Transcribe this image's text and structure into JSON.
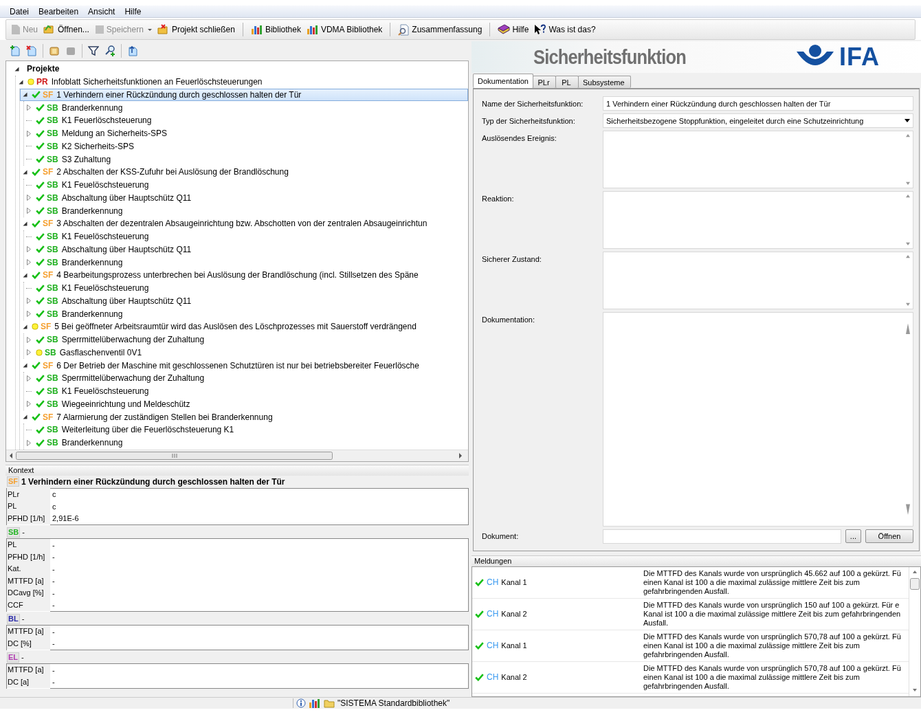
{
  "menu": [
    {
      "label": "Datei"
    },
    {
      "label": "Bearbeiten"
    },
    {
      "label": "Ansicht"
    },
    {
      "label": "Hilfe"
    }
  ],
  "toolbar": {
    "groups": [
      {
        "buttons": [
          {
            "label": "Neu",
            "disabled": true,
            "dropdown": false
          },
          {
            "label": "Öffnen...",
            "disabled": false,
            "dropdown": false
          },
          {
            "label": "Speichern",
            "disabled": true,
            "dropdown": true
          },
          {
            "label": "Projekt schließen",
            "disabled": false,
            "dropdown": false
          }
        ]
      },
      {
        "buttons": [
          {
            "label": "Bibliothek",
            "disabled": false,
            "dropdown": false
          },
          {
            "label": "VDMA Bibliothek",
            "disabled": false,
            "dropdown": false
          }
        ]
      },
      {
        "buttons": [
          {
            "label": "Zusammenfassung",
            "disabled": false,
            "dropdown": false
          }
        ]
      },
      {
        "buttons": [
          {
            "label": "Hilfe",
            "disabled": false,
            "dropdown": false
          },
          {
            "label": "Was ist das?",
            "disabled": false,
            "dropdown": false
          }
        ]
      }
    ]
  },
  "tree": {
    "items": [
      {
        "kind": "root",
        "label": "Projekte",
        "expanded": true,
        "selected": false,
        "children": [
          {
            "kind": "project",
            "tag": "PR",
            "complete": false,
            "label": "Infoblatt Sicherheitsfunktionen an Feuerlöschsteuerungen",
            "expanded": true,
            "selected": false,
            "children": [
              {
                "kind": "function",
                "tag": "SF",
                "complete": true,
                "label": "1 Verhindern einer Rückzündung durch geschlossen halten der Tür",
                "expanded": true,
                "selected": true,
                "children": [
                  {
                    "kind": "subsystem",
                    "tag": "SB",
                    "complete": true,
                    "label": "Branderkennung",
                    "expanded": false,
                    "selected": false
                  },
                  {
                    "kind": "subsystem",
                    "tag": "SB",
                    "complete": true,
                    "label": "K1 Feuerlöschsteuerung",
                    "selected": false
                  },
                  {
                    "kind": "subsystem",
                    "tag": "SB",
                    "complete": true,
                    "label": "Meldung an Sicherheits-SPS",
                    "expanded": false,
                    "selected": false
                  },
                  {
                    "kind": "subsystem",
                    "tag": "SB",
                    "complete": true,
                    "label": "K2 Sicherheits-SPS",
                    "selected": false
                  },
                  {
                    "kind": "subsystem",
                    "tag": "SB",
                    "complete": true,
                    "label": "S3 Zuhaltung",
                    "selected": false
                  }
                ]
              },
              {
                "kind": "function",
                "tag": "SF",
                "complete": true,
                "label": "2 Abschalten der KSS-Zufuhr bei Auslösung der Brandlöschung",
                "expanded": true,
                "selected": false,
                "children": [
                  {
                    "kind": "subsystem",
                    "tag": "SB",
                    "complete": true,
                    "label": "K1 Feuelöschsteuerung",
                    "selected": false
                  },
                  {
                    "kind": "subsystem",
                    "tag": "SB",
                    "complete": true,
                    "label": "Abschaltung über Hauptschütz Q11",
                    "expanded": false,
                    "selected": false
                  },
                  {
                    "kind": "subsystem",
                    "tag": "SB",
                    "complete": true,
                    "label": "Branderkennung",
                    "expanded": false,
                    "selected": false
                  }
                ]
              },
              {
                "kind": "function",
                "tag": "SF",
                "complete": true,
                "label": "3 Abschalten der dezentralen Absaugeinrichtung bzw. Abschotten von der zentralen Absaugeinrichtun",
                "expanded": true,
                "selected": false,
                "children": [
                  {
                    "kind": "subsystem",
                    "tag": "SB",
                    "complete": true,
                    "label": "K1 Feuelöschsteuerung",
                    "selected": false
                  },
                  {
                    "kind": "subsystem",
                    "tag": "SB",
                    "complete": true,
                    "label": "Abschaltung über Hauptschütz Q11",
                    "expanded": false,
                    "selected": false
                  },
                  {
                    "kind": "subsystem",
                    "tag": "SB",
                    "complete": true,
                    "label": "Branderkennung",
                    "expanded": false,
                    "selected": false
                  }
                ]
              },
              {
                "kind": "function",
                "tag": "SF",
                "complete": true,
                "label": "4 Bearbeitungsprozess unterbrechen bei Auslösung der Brandlöschung (incl. Stillsetzen des Späne",
                "expanded": true,
                "selected": false,
                "children": [
                  {
                    "kind": "subsystem",
                    "tag": "SB",
                    "complete": true,
                    "label": "K1 Feuelöschsteuerung",
                    "selected": false
                  },
                  {
                    "kind": "subsystem",
                    "tag": "SB",
                    "complete": true,
                    "label": "Abschaltung über Hauptschütz Q11",
                    "expanded": false,
                    "selected": false
                  },
                  {
                    "kind": "subsystem",
                    "tag": "SB",
                    "complete": true,
                    "label": "Branderkennung",
                    "expanded": false,
                    "selected": false
                  }
                ]
              },
              {
                "kind": "function",
                "tag": "SF",
                "complete": false,
                "label": "5 Bei geöffneter Arbeitsraumtür wird das Auslösen des Löschprozesses mit Sauerstoff verdrängend",
                "expanded": true,
                "selected": false,
                "children": [
                  {
                    "kind": "subsystem",
                    "tag": "SB",
                    "complete": true,
                    "label": "Sperrmittelüberwachung der Zuhaltung",
                    "expanded": false,
                    "selected": false
                  },
                  {
                    "kind": "subsystem",
                    "tag": "SB",
                    "complete": false,
                    "label": "Gasflaschenventil 0V1",
                    "expanded": false,
                    "selected": false
                  }
                ]
              },
              {
                "kind": "function",
                "tag": "SF",
                "complete": true,
                "label": "6 Der Betrieb der Maschine mit geschlossenen Schutztüren ist nur bei betriebsbereiter Feuerlösche",
                "expanded": true,
                "selected": false,
                "children": [
                  {
                    "kind": "subsystem",
                    "tag": "SB",
                    "complete": true,
                    "label": "Sperrmittelüberwachung der Zuhaltung",
                    "expanded": false,
                    "selected": false
                  },
                  {
                    "kind": "subsystem",
                    "tag": "SB",
                    "complete": true,
                    "label": "K1 Feuelöschsteuerung",
                    "selected": false
                  },
                  {
                    "kind": "subsystem",
                    "tag": "SB",
                    "complete": true,
                    "label": "Wiegeeinrichtung und Meldeschütz",
                    "expanded": false,
                    "selected": false
                  }
                ]
              },
              {
                "kind": "function",
                "tag": "SF",
                "complete": true,
                "label": "7 Alarmierung der zuständigen Stellen bei Branderkennung",
                "expanded": true,
                "selected": false,
                "children": [
                  {
                    "kind": "subsystem",
                    "tag": "SB",
                    "complete": true,
                    "label": "Weiterleitung über die Feuerlöschsteuerung K1",
                    "selected": false
                  },
                  {
                    "kind": "subsystem",
                    "tag": "SB",
                    "complete": true,
                    "label": "Branderkennung",
                    "expanded": false,
                    "selected": false
                  }
                ]
              }
            ]
          }
        ]
      }
    ]
  },
  "context": {
    "title": "Kontext",
    "groups": [
      {
        "tag": "SF",
        "color": "#f5a030",
        "text": "1 Verhindern einer Rückzündung durch geschlossen halten der Tür",
        "rows": [
          {
            "label": "PLr",
            "value": "c"
          },
          {
            "label": "PL",
            "value": "c"
          },
          {
            "label": "PFHD [1/h]",
            "value": "2,91E-6"
          }
        ]
      },
      {
        "tag": "SB",
        "color": "#22b422",
        "text": "-",
        "rows": [
          {
            "label": "PL",
            "value": "-"
          },
          {
            "label": "PFHD [1/h]",
            "value": "-"
          },
          {
            "label": "Kat.",
            "value": "-"
          },
          {
            "label": "MTTFD [a]",
            "value": "-"
          },
          {
            "label": "DCavg [%]",
            "value": "-"
          },
          {
            "label": "CCF",
            "value": "-"
          }
        ]
      },
      {
        "tag": "BL",
        "color": "#2a2aa8",
        "text": "-",
        "rows": [
          {
            "label": "MTTFD [a]",
            "value": "-"
          },
          {
            "label": "DC [%]",
            "value": "-"
          }
        ]
      },
      {
        "tag": "EL",
        "color": "#b03cb0",
        "text": "-",
        "rows": [
          {
            "label": "MTTFD [a]",
            "value": "-"
          },
          {
            "label": "DC [a]",
            "value": "-"
          }
        ]
      }
    ]
  },
  "header": {
    "title": "Sicherheitsfunktion",
    "logo": "IFA"
  },
  "form": {
    "tabs": [
      {
        "label": "Dokumentation",
        "selected": true
      },
      {
        "label": "PLr",
        "selected": false
      },
      {
        "label": "PL",
        "selected": false
      },
      {
        "label": "Subsysteme",
        "selected": false
      }
    ],
    "fields": [
      {
        "kind": "text",
        "label": "Name der Sicherheitsfunktion:",
        "value": "1 Verhindern einer Rückzündung durch geschlossen halten der Tür"
      },
      {
        "kind": "select",
        "label": "Typ der Sicherheitsfunktion:",
        "value": "Sicherheitsbezogene Stoppfunktion, eingeleitet durch eine Schutzeinrichtung"
      },
      {
        "kind": "textarea",
        "label": "Auslösendes Ereignis:"
      },
      {
        "kind": "textarea",
        "label": "Reaktion:"
      },
      {
        "kind": "textarea",
        "label": "Sicherer Zustand:"
      },
      {
        "kind": "textarea",
        "label": "Dokumentation:"
      }
    ],
    "document": {
      "label": "Dokument:",
      "browse": "...",
      "open": "Öffnen"
    }
  },
  "messages": {
    "title": "Meldungen",
    "rows": [
      {
        "complete": true,
        "tag": "CH",
        "name": "Kanal 1",
        "lines": [
          "Die MTTFD des Kanals wurde von ursprünglich 45.662 auf 100 a gekürzt. Fü",
          "einen Kanal ist 100 a die maximal zulässige mittlere Zeit bis zum",
          "gefahrbringenden Ausfall."
        ]
      },
      {
        "complete": true,
        "tag": "CH",
        "name": "Kanal 2",
        "lines": [
          "Die MTTFD des Kanals wurde von ursprünglich 150 auf 100 a gekürzt. Für e",
          "Kanal ist 100 a die maximal zulässige mittlere Zeit bis zum gefahrbringenden",
          "Ausfall."
        ]
      },
      {
        "complete": true,
        "tag": "CH",
        "name": "Kanal 1",
        "lines": [
          "Die MTTFD des Kanals wurde von ursprünglich 570,78 auf 100 a gekürzt. Fü",
          "einen Kanal ist 100 a die maximal zulässige mittlere Zeit bis zum",
          "gefahrbringenden Ausfall."
        ]
      },
      {
        "complete": true,
        "tag": "CH",
        "name": "Kanal 2",
        "lines": [
          "Die MTTFD des Kanals wurde von ursprünglich 570,78 auf 100 a gekürzt. Fü",
          "einen Kanal ist 100 a die maximal zulässige mittlere Zeit bis zum",
          "gefahrbringenden Ausfall."
        ]
      }
    ]
  },
  "status_bar": {
    "text": "\"SISTEMA Standardbibliothek\""
  }
}
